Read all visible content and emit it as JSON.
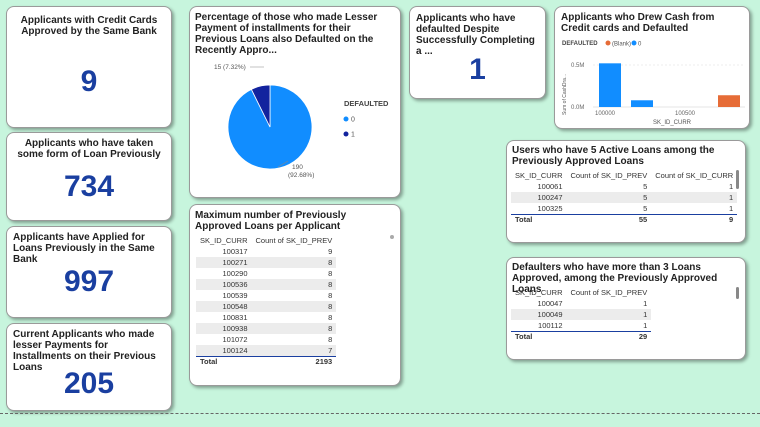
{
  "kpis": [
    {
      "title": "Applicants with Credit Cards Approved by the Same Bank",
      "value": "9"
    },
    {
      "title": "Applicants who have taken some form of Loan Previously",
      "value": "734"
    },
    {
      "title": "Applicants have Applied for Loans Previously in the Same Bank",
      "value": "997"
    },
    {
      "title": "Current Applicants who made lesser Payments for Installments on their Previous Loans",
      "value": "205"
    }
  ],
  "pie": {
    "title": "Percentage of those who made Lesser Payment of installments for their Previous Loans also Defaulted on the Recently Appro...",
    "legend_title": "DEFAULTED",
    "slices": [
      {
        "label": "0",
        "value": 190,
        "pct": "92.68%",
        "color": "#118dff"
      },
      {
        "label": "1",
        "value": 15,
        "pct": "7.32%",
        "color": "#12239e"
      }
    ],
    "label_small": "15 (7.32%)",
    "label_big_1": "190",
    "label_big_2": "(92.68%)"
  },
  "defaulted_kpi": {
    "title": "Applicants who have defaulted Despite Successfully Completing a ...",
    "value": "1"
  },
  "cash_chart": {
    "title": "Applicants who Drew Cash from Credit cards and Defaulted",
    "legend_title": "DEFAULTED",
    "legend_items": [
      {
        "label": "(Blank)",
        "color": "#e66c37"
      },
      {
        "label": "0",
        "color": "#118dff"
      }
    ],
    "ylabel": "Sum of CashDra...",
    "xlabel": "SK_ID_CURR",
    "yticks": [
      "0.5M",
      "0.0M"
    ],
    "xticks": [
      "100000",
      "100500"
    ],
    "chart_data": {
      "type": "bar",
      "ylabel": "Sum of CashDra...",
      "xlabel": "SK_ID_CURR",
      "ylim": [
        0,
        0.6
      ],
      "series": [
        {
          "name": "0",
          "values": [
            0.52,
            0.08
          ]
        },
        {
          "name": "(Blank)",
          "values": [
            0.14
          ]
        }
      ]
    }
  },
  "max_prev": {
    "title": "Maximum number of Previously Approved Loans per Applicant",
    "headers": [
      "SK_ID_CURR",
      "Count of SK_ID_PREV"
    ],
    "rows": [
      [
        "100317",
        "9"
      ],
      [
        "100271",
        "8"
      ],
      [
        "100290",
        "8"
      ],
      [
        "100536",
        "8"
      ],
      [
        "100539",
        "8"
      ],
      [
        "100548",
        "8"
      ],
      [
        "100831",
        "8"
      ],
      [
        "100938",
        "8"
      ],
      [
        "101072",
        "8"
      ],
      [
        "100124",
        "7"
      ]
    ],
    "total": [
      "Total",
      "2193"
    ]
  },
  "five_active": {
    "title": "Users who have 5 Active Loans among the Previously Approved Loans",
    "headers": [
      "SK_ID_CURR",
      "Count of SK_ID_PREV",
      "Count of SK_ID_CURR"
    ],
    "rows": [
      [
        "100061",
        "5",
        "1"
      ],
      [
        "100247",
        "5",
        "1"
      ],
      [
        "100325",
        "5",
        "1"
      ]
    ],
    "total": [
      "Total",
      "55",
      "9"
    ]
  },
  "defaulters3": {
    "title": "Defaulters who have more than 3 Loans Approved, among the Previously Approved Loans",
    "headers": [
      "SK_ID_CURR",
      "Count of SK_ID_PREV"
    ],
    "rows": [
      [
        "100047",
        "1"
      ],
      [
        "100049",
        "1"
      ],
      [
        "100112",
        "1"
      ]
    ],
    "total": [
      "Total",
      "29"
    ]
  }
}
